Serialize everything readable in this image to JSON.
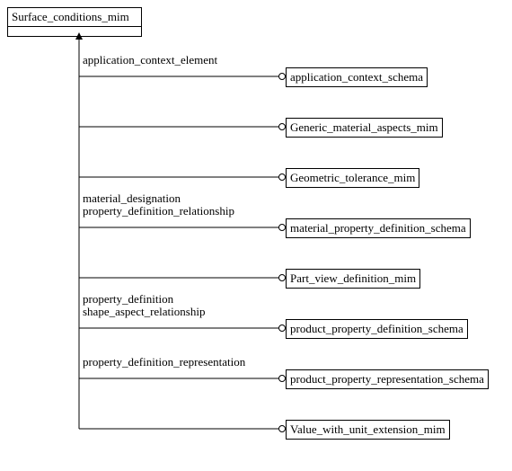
{
  "root": {
    "title": "Surface_conditions_mim"
  },
  "targets": [
    {
      "label": "application_context_schema"
    },
    {
      "label": "Generic_material_aspects_mim"
    },
    {
      "label": "Geometric_tolerance_mim"
    },
    {
      "label": "material_property_definition_schema"
    },
    {
      "label": "Part_view_definition_mim"
    },
    {
      "label": "product_property_definition_schema"
    },
    {
      "label": "product_property_representation_schema"
    },
    {
      "label": "Value_with_unit_extension_mim"
    }
  ],
  "edge_labels": [
    {
      "text": "application_context_element"
    },
    {
      "text": "material_designation\nproperty_definition_relationship"
    },
    {
      "text": "property_definition\nshape_aspect_relationship"
    },
    {
      "text": "property_definition_representation"
    }
  ]
}
